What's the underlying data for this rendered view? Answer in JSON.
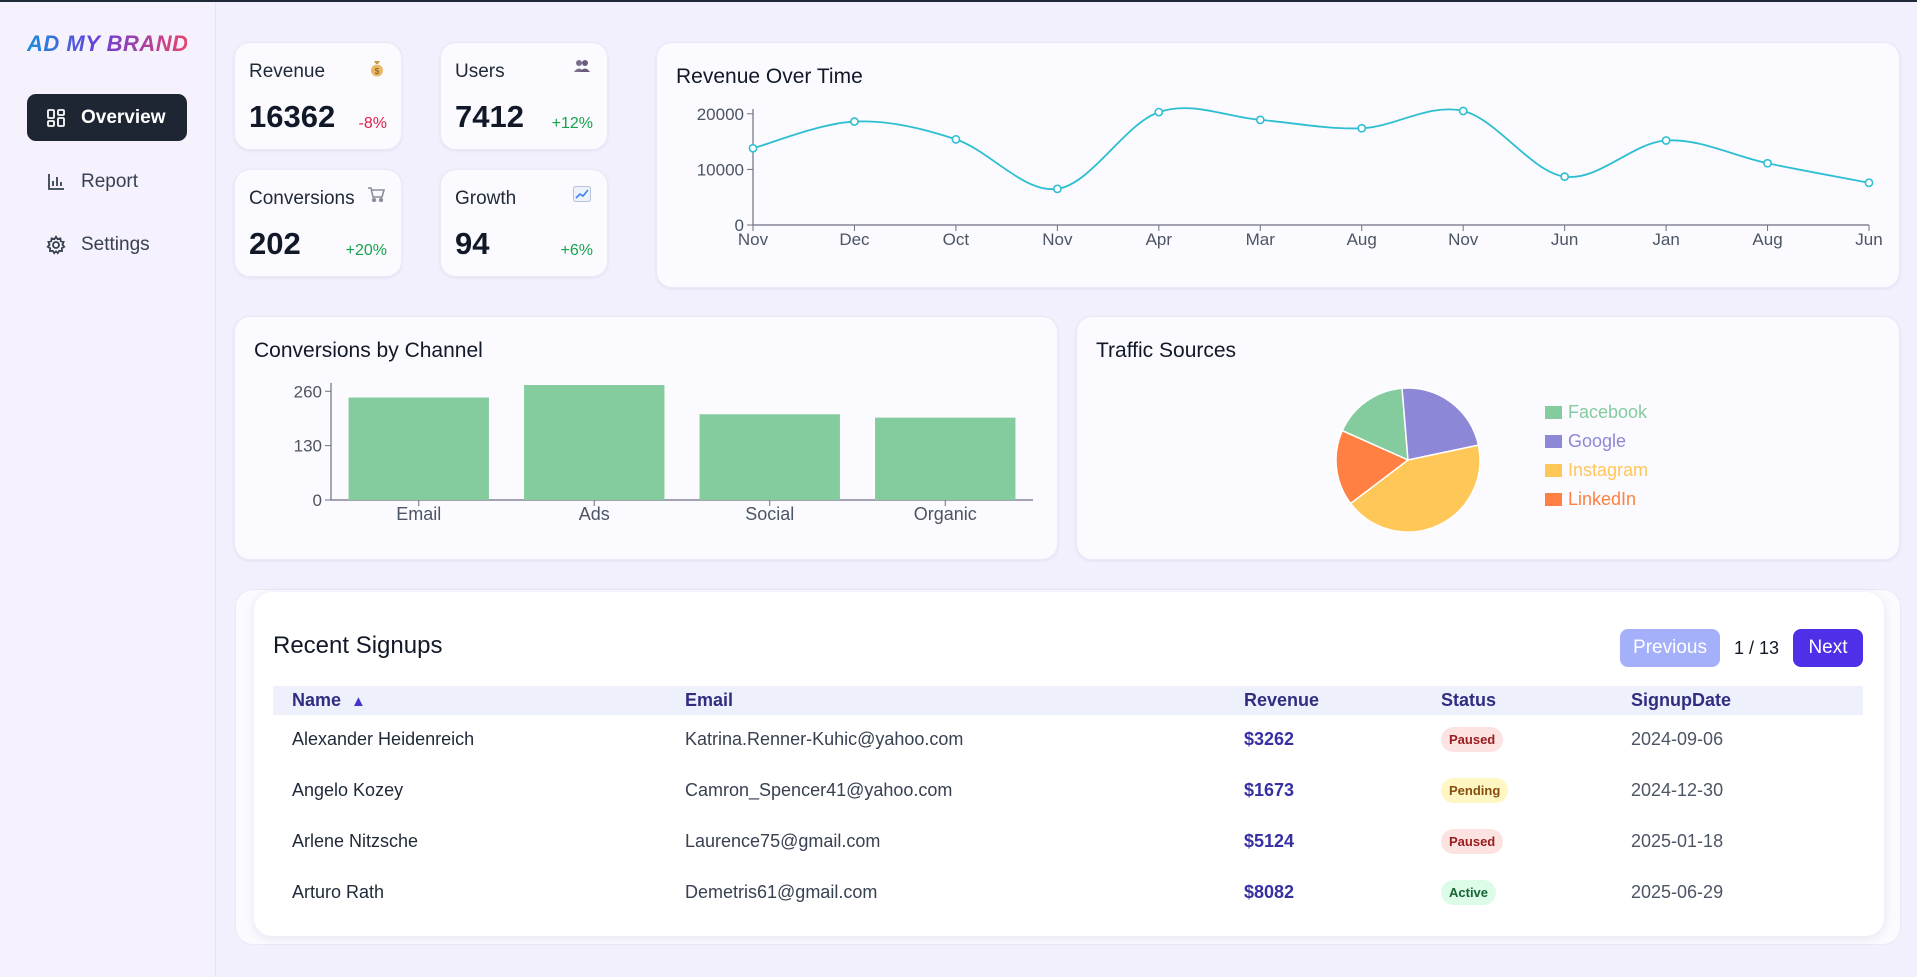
{
  "brand": {
    "logo_text": "AD MY BRAND"
  },
  "sidebar": {
    "items": [
      {
        "label": "Overview",
        "icon": "dashboard-icon",
        "active": true
      },
      {
        "label": "Report",
        "icon": "bar-chart-icon",
        "active": false
      },
      {
        "label": "Settings",
        "icon": "gear-icon",
        "active": false
      }
    ]
  },
  "stats": [
    {
      "label": "Revenue",
      "icon": "money-bag-icon",
      "value": "16362",
      "change": "-8%"
    },
    {
      "label": "Users",
      "icon": "users-icon",
      "value": "7412",
      "change": "+12%"
    },
    {
      "label": "Conversions",
      "icon": "cart-icon",
      "value": "202",
      "change": "+20%"
    },
    {
      "label": "Growth",
      "icon": "trend-chart-icon",
      "value": "94",
      "change": "+6%"
    }
  ],
  "colors": {
    "line": "#2dbfcf",
    "bar": "#84cb9e",
    "facebook": "#84cb9e",
    "google": "#8c87d6",
    "instagram": "#ffc658",
    "linkedin": "#ff8042",
    "primary": "#4f2fe8",
    "sidebar_active": "#1e2533"
  },
  "chart_data": [
    {
      "type": "line",
      "title": "Revenue Over Time",
      "x": [
        "Nov",
        "Dec",
        "Oct",
        "Nov",
        "Apr",
        "Mar",
        "Aug",
        "Nov",
        "Jun",
        "Jan",
        "Aug",
        "Jun"
      ],
      "values": [
        13800,
        18600,
        15400,
        6500,
        20300,
        18900,
        17400,
        20500,
        8700,
        15200,
        11100,
        7600
      ],
      "yticks": [
        0,
        10000,
        20000
      ],
      "ylim": [
        0,
        20500
      ],
      "grid": false
    },
    {
      "type": "bar",
      "title": "Conversions by Channel",
      "categories": [
        "Email",
        "Ads",
        "Social",
        "Organic"
      ],
      "values": [
        245,
        275,
        205,
        197
      ],
      "yticks": [
        0,
        130,
        260
      ],
      "ylim": [
        0,
        275
      ],
      "grid": false
    },
    {
      "type": "pie",
      "title": "Traffic Sources",
      "labels": [
        "Facebook",
        "Google",
        "Instagram",
        "LinkedIn"
      ],
      "values": [
        17,
        23,
        43,
        17
      ],
      "legend": "right"
    }
  ],
  "table": {
    "title": "Recent Signups",
    "prev_label": "Previous",
    "next_label": "Next",
    "page_info": "1 / 13",
    "sort_indicator": "▲",
    "columns": [
      "Name",
      "Email",
      "Revenue",
      "Status",
      "SignupDate"
    ],
    "rows": [
      {
        "name": "Alexander Heidenreich",
        "email": "Katrina.Renner-Kuhic@yahoo.com",
        "revenue": "$3262",
        "status": "Paused",
        "date": "2024-09-06"
      },
      {
        "name": "Angelo Kozey",
        "email": "Camron_Spencer41@yahoo.com",
        "revenue": "$1673",
        "status": "Pending",
        "date": "2024-12-30"
      },
      {
        "name": "Arlene Nitzsche",
        "email": "Laurence75@gmail.com",
        "revenue": "$5124",
        "status": "Paused",
        "date": "2025-01-18"
      },
      {
        "name": "Arturo Rath",
        "email": "Demetris61@gmail.com",
        "revenue": "$8082",
        "status": "Active",
        "date": "2025-06-29"
      }
    ]
  }
}
